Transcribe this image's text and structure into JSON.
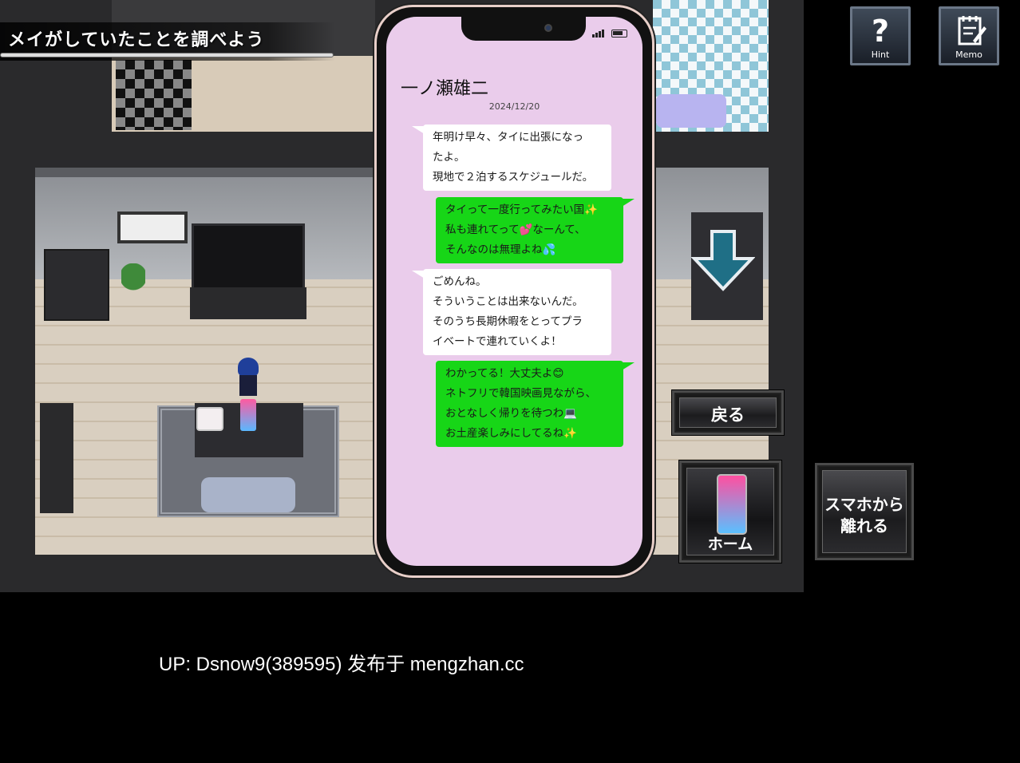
{
  "objective": {
    "text": "メイがしていたことを調べよう"
  },
  "hud": {
    "hint_label": "Hint",
    "hint_icon": "question-mark-icon",
    "memo_label": "Memo",
    "memo_icon": "notepad-icon"
  },
  "phone": {
    "contact_name": "一ノ瀬雄二",
    "date": "2024/12/20",
    "messages": [
      {
        "side": "received",
        "lines": [
          "年明け早々、タイに出張になっ",
          "たよ。",
          "現地で２泊するスケジュールだ。"
        ]
      },
      {
        "side": "sent",
        "lines": [
          "タイって一度行ってみたい国✨",
          "私も連れてって💕なーんて、",
          "そんなのは無理よね💦"
        ]
      },
      {
        "side": "received",
        "lines": [
          "ごめんね。",
          "そういうことは出来ないんだ。",
          "そのうち長期休暇をとってプラ",
          "イベートで連れていくよ！"
        ]
      },
      {
        "side": "sent",
        "lines": [
          "わかってる！大丈夫よ😊",
          "ネトフリで韓国映画見ながら、",
          "おとなしく帰りを待つわ💻",
          "お土産楽しみにしてるね✨"
        ]
      }
    ]
  },
  "buttons": {
    "back": "戻る",
    "home": "ホーム",
    "leave_line1": "スマホから",
    "leave_line2": "離れる"
  },
  "scene": {
    "down_arrow_icon": "down-arrow-icon",
    "arrow_color": "#1f6f86"
  },
  "watermark": "UP: Dsnow9(389595) 发布于 mengzhan.cc"
}
